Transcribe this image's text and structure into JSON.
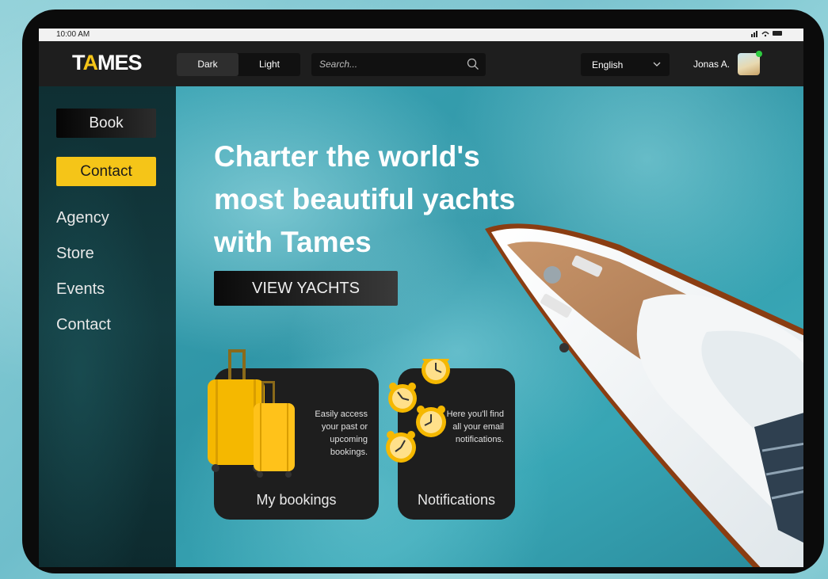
{
  "status_bar": {
    "time": "10:00 AM",
    "indicators": "signal wifi battery"
  },
  "header": {
    "logo": {
      "part1": "T",
      "accent": "A",
      "part2": "MES"
    },
    "theme_toggle": {
      "dark": "Dark",
      "light": "Light",
      "selected": "Dark"
    },
    "search": {
      "placeholder": "Search..."
    },
    "language": {
      "selected": "English"
    },
    "user": {
      "name": "Jonas A.",
      "online": true
    }
  },
  "sidebar": {
    "book": "Book",
    "contact_button": "Contact",
    "links": [
      "Agency",
      "Store",
      "Events",
      "Contact"
    ]
  },
  "hero": {
    "title_lines": [
      "Charter the world's",
      "most beautiful yachts",
      "with Tames"
    ],
    "cta": "VIEW YACHTS"
  },
  "cards": [
    {
      "title": "My bookings",
      "description": "Easily access your past or upcoming bookings.",
      "icon": "suitcase-icon"
    },
    {
      "title": "Notifications",
      "description": "Here you'll find all your email notifications.",
      "icon": "alarm-clock-icon"
    }
  ],
  "colors": {
    "accent": "#f5c518",
    "dark": "#1e1e1e",
    "water": "#38a6b5",
    "online": "#2ecc40"
  }
}
